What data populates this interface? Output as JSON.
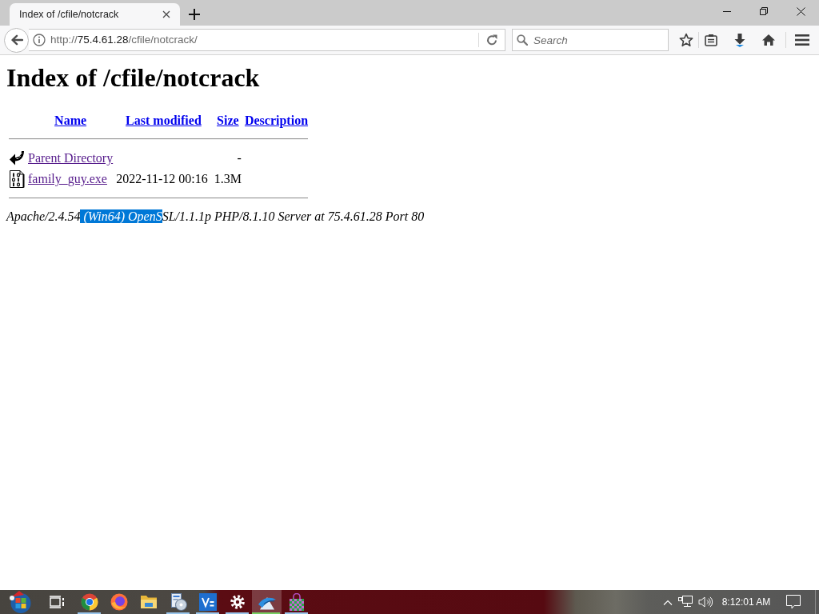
{
  "browser": {
    "tabs": [
      {
        "title": "Index of /cfile/notcrack",
        "selected": true
      }
    ],
    "address": {
      "scheme": "http://",
      "host": "75.4.61.28",
      "path": "/cfile/notcrack/"
    },
    "search": {
      "placeholder": "Search"
    }
  },
  "page": {
    "heading": "Index of /cfile/notcrack",
    "columns": [
      "Name",
      "Last modified",
      "Size",
      "Description"
    ],
    "rows": [
      {
        "kind": "parent",
        "name": "Parent Directory",
        "size": "-",
        "visited": true
      },
      {
        "kind": "binary",
        "name": "family_guy.exe",
        "last_modified": "2022-11-12 00:16",
        "size": "1.3M",
        "visited": true
      }
    ],
    "server_signature": [
      {
        "text": "Apache/2.4.54",
        "selected": false
      },
      {
        "text": " (Win64) OpenS",
        "selected": true
      },
      {
        "text": "SL/1.1.1p PHP/8.1.10 Server at 75.4.61.28 Port 80",
        "selected": false
      }
    ]
  },
  "taskbar": {
    "apps": [
      {
        "running": true,
        "active": false
      },
      {
        "running": false,
        "active": false
      },
      {
        "running": false,
        "active": false
      },
      {
        "running": true,
        "active": false
      },
      {
        "running": true,
        "active": false
      },
      {
        "running": true,
        "active": false
      },
      {
        "running": true,
        "active": true
      },
      {
        "running": true,
        "active": false
      }
    ],
    "clock": "8:12:01 AM"
  }
}
